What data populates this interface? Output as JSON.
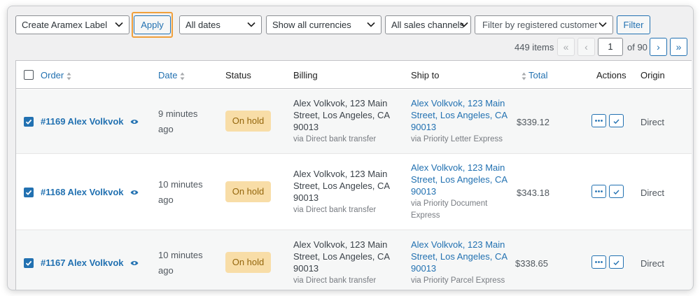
{
  "toolbar": {
    "bulk_action": "Create Aramex Label",
    "apply_label": "Apply",
    "dates_filter": "All dates",
    "currency_filter": "Show all currencies",
    "channel_filter": "All sales channels",
    "customer_filter_placeholder": "Filter by registered customer",
    "filter_label": "Filter"
  },
  "pagination": {
    "items_count": "449 items",
    "first": "«",
    "prev": "‹",
    "current_page": "1",
    "of_pages": "of 90",
    "next": "›",
    "last": "»"
  },
  "columns": {
    "order": "Order",
    "date": "Date",
    "status": "Status",
    "billing": "Billing",
    "ship_to": "Ship to",
    "total": "Total",
    "actions": "Actions",
    "origin": "Origin"
  },
  "rows": [
    {
      "order": "#1169 Alex Volkvok",
      "date_line1": "9 minutes",
      "date_line2": "ago",
      "status": "On hold",
      "billing_line1": "Alex Volkvok, 123 Main",
      "billing_line2": "Street, Los Angeles, CA",
      "billing_line3": "90013",
      "billing_via": "via Direct bank transfer",
      "ship_line1": "Alex Volkvok, 123 Main",
      "ship_line2": "Street, Los Angeles, CA",
      "ship_line3": "90013",
      "ship_via_line1": "via Priority Letter Express",
      "ship_via_line2": "",
      "total": "$339.12",
      "origin": "Direct"
    },
    {
      "order": "#1168 Alex Volkvok",
      "date_line1": "10 minutes",
      "date_line2": "ago",
      "status": "On hold",
      "billing_line1": "Alex Volkvok, 123 Main",
      "billing_line2": "Street, Los Angeles, CA",
      "billing_line3": "90013",
      "billing_via": "via Direct bank transfer",
      "ship_line1": "Alex Volkvok, 123 Main",
      "ship_line2": "Street, Los Angeles, CA",
      "ship_line3": "90013",
      "ship_via_line1": "via Priority Document",
      "ship_via_line2": "Express",
      "total": "$343.18",
      "origin": "Direct"
    },
    {
      "order": "#1167 Alex Volkvok",
      "date_line1": "10 minutes",
      "date_line2": "ago",
      "status": "On hold",
      "billing_line1": "Alex Volkvok, 123 Main",
      "billing_line2": "Street, Los Angeles, CA",
      "billing_line3": "90013",
      "billing_via": "via Direct bank transfer",
      "ship_line1": "Alex Volkvok, 123 Main",
      "ship_line2": "Street, Los Angeles, CA",
      "ship_line3": "90013",
      "ship_via_line1": "via Priority Parcel Express",
      "ship_via_line2": "",
      "total": "$338.65",
      "origin": "Direct"
    }
  ],
  "colors": {
    "accent": "#2271b1",
    "on_hold_bg": "#f8dda7",
    "on_hold_text": "#94660c",
    "highlight": "#f0a03c"
  },
  "icons": {
    "preview": "eye-icon",
    "more": "ellipsis-icon",
    "complete": "checkmark-icon",
    "sort": "sort-arrows-icon",
    "dropdown": "chevron-down-icon"
  }
}
